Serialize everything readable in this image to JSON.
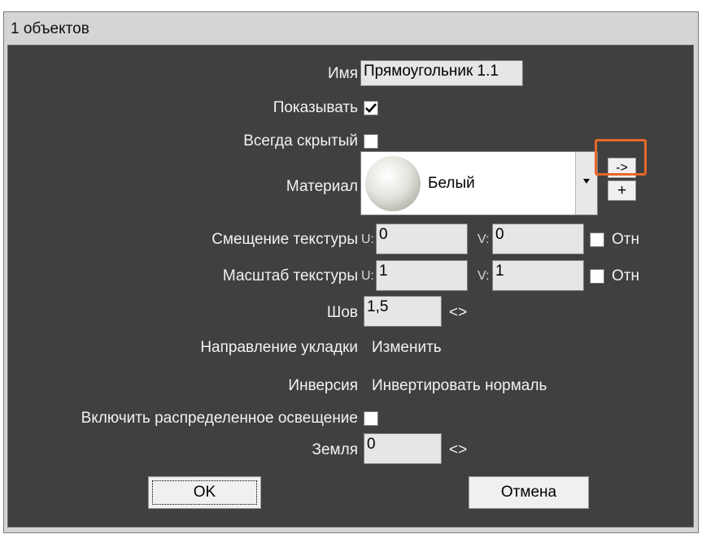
{
  "window": {
    "title": "1 объектов"
  },
  "fields": {
    "name_label": "Имя",
    "name_value": "Прямоугольник 1.1",
    "show_label": "Показывать",
    "always_hidden_label": "Всегда скрытый",
    "material_label": "Материал",
    "material_value": "Белый",
    "material_arrow_label": "->",
    "material_add_label": "+",
    "tex_offset_label": "Смещение текстуры",
    "tex_offset_u_prefix": "U:",
    "tex_offset_u": "0",
    "tex_offset_v_prefix": "V:",
    "tex_offset_v": "0",
    "tex_offset_rel_label": "Отн",
    "tex_scale_label": "Масштаб текстуры",
    "tex_scale_u_prefix": "U:",
    "tex_scale_u": "1",
    "tex_scale_v_prefix": "V:",
    "tex_scale_v": "1",
    "tex_scale_rel_label": "Отн",
    "seam_label": "Шов",
    "seam_value": "1,5",
    "seam_adjust": "<>",
    "direction_label": "Направление укладки",
    "direction_action": "Изменить",
    "inversion_label": "Инверсия",
    "inversion_action": "Инвертировать нормаль",
    "distributed_light_label": "Включить распределенное освещение",
    "ground_label": "Земля",
    "ground_value": "0",
    "ground_adjust": "<>"
  },
  "buttons": {
    "ok": "OK",
    "cancel": "Отмена"
  },
  "state": {
    "show_checked": true,
    "always_hidden_checked": false,
    "offset_rel_checked": false,
    "scale_rel_checked": false,
    "distributed_light_checked": false
  },
  "colors": {
    "panel": "#404040",
    "highlight": "#e8672a",
    "text": "#f2f2f2"
  }
}
